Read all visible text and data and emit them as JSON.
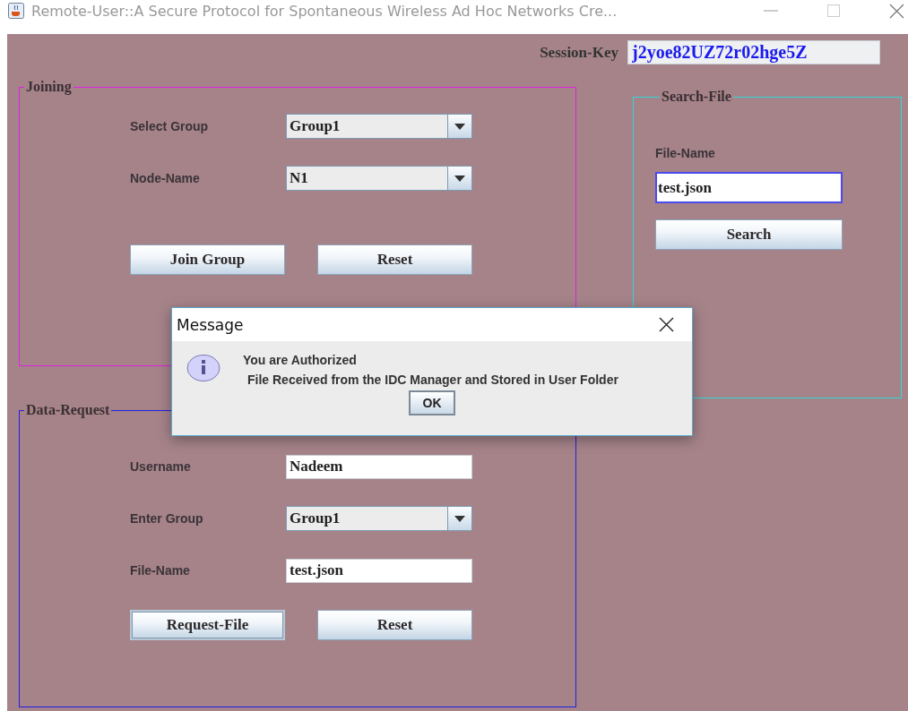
{
  "window": {
    "title": "Remote-User::A Secure Protocol for Spontaneous Wireless Ad Hoc Networks Cre..."
  },
  "session_key": {
    "label": "Session-Key",
    "value": "j2yoe82UZ72r02hge5Z"
  },
  "panels": [
    {
      "title": "Joining",
      "color": "#e020e0",
      "kind": "inline",
      "rows": [
        {
          "kind": "combo",
          "label": "Select Group",
          "value": "Group1",
          "focused": false
        },
        {
          "kind": "combo",
          "label": "Node-Name",
          "value": "N1",
          "focused": false
        }
      ],
      "buttons": [
        {
          "label": "Join Group",
          "focused": false
        },
        {
          "label": "Reset",
          "focused": false
        }
      ]
    },
    {
      "title": "Data-Request",
      "color": "#2020e0",
      "kind": "inline",
      "rows": [
        {
          "kind": "text",
          "label": "Username",
          "value": "Nadeem",
          "focused": false
        },
        {
          "kind": "combo",
          "label": "Enter Group",
          "value": "Group1",
          "focused": false
        },
        {
          "kind": "text",
          "label": "File-Name",
          "value": "test.json",
          "focused": false
        }
      ],
      "buttons": [
        {
          "label": "Request-File",
          "focused": true
        },
        {
          "label": "Reset",
          "focused": false
        }
      ]
    },
    {
      "title": "Search-File",
      "color": "#30d8d8",
      "kind": "stacked",
      "rows": [
        {
          "kind": "text",
          "label": "File-Name",
          "value": "test.json",
          "focused": true
        }
      ],
      "buttons": [
        {
          "label": "Search",
          "focused": false
        }
      ]
    }
  ],
  "dialog": {
    "title": "Message",
    "lines": [
      "You are Authorized",
      "File Received from the IDC Manager and Stored in User Folder"
    ],
    "button": "OK"
  }
}
